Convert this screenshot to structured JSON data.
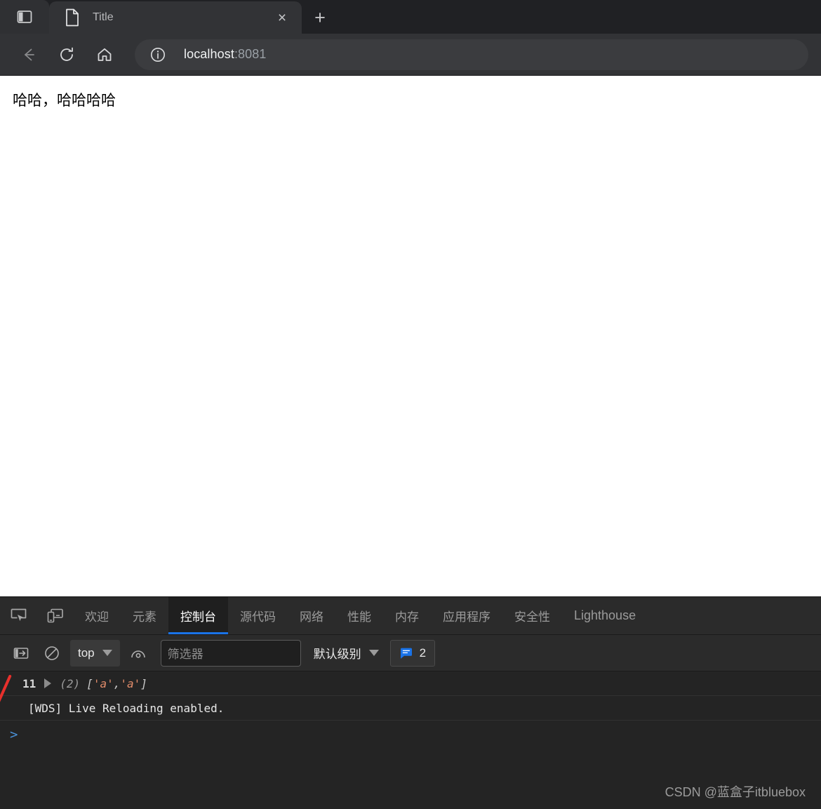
{
  "browser": {
    "panel_toggle_icon": "split-panel-icon",
    "tab": {
      "favicon": "document-icon",
      "title": "Title",
      "close_label": "×"
    },
    "new_tab_label": "+",
    "nav": {
      "back_icon": "arrow-left-icon",
      "reload_icon": "reload-icon",
      "home_icon": "home-icon"
    },
    "omnibox": {
      "info_icon": "info-circle-icon",
      "host": "localhost",
      "port": ":8081"
    }
  },
  "page": {
    "text": "哈哈，哈哈哈哈"
  },
  "devtools": {
    "inspect_icon": "inspect-cursor-icon",
    "device_icon": "device-toolbar-icon",
    "tabs": [
      {
        "label": "欢迎",
        "active": false,
        "latin": false
      },
      {
        "label": "元素",
        "active": false,
        "latin": false
      },
      {
        "label": "控制台",
        "active": true,
        "latin": false
      },
      {
        "label": "源代码",
        "active": false,
        "latin": false
      },
      {
        "label": "网络",
        "active": false,
        "latin": false
      },
      {
        "label": "性能",
        "active": false,
        "latin": false
      },
      {
        "label": "内存",
        "active": false,
        "latin": false
      },
      {
        "label": "应用程序",
        "active": false,
        "latin": false
      },
      {
        "label": "安全性",
        "active": false,
        "latin": false
      },
      {
        "label": "Lighthouse",
        "active": false,
        "latin": true
      }
    ],
    "toolbar": {
      "sidebar_icon": "console-sidebar-icon",
      "clear_icon": "clear-console-icon",
      "context": "top",
      "eye_icon": "live-expression-eye-icon",
      "filter_placeholder": "筛选器",
      "filter_value": "",
      "level": "默认级别",
      "message_badge": {
        "icon": "message-bubble-icon",
        "count": "2",
        "color": "#1a73e8"
      }
    },
    "console": {
      "entries": [
        {
          "line_number": "11",
          "has_disclosure": true,
          "count": "(2)",
          "bracket_open": "[",
          "items": [
            "'a'",
            "'a'"
          ],
          "separator": ", ",
          "bracket_close": "]"
        },
        {
          "text": "[WDS] Live Reloading enabled."
        }
      ],
      "prompt": ">"
    }
  },
  "watermark": "CSDN @蓝盒子itbluebox"
}
